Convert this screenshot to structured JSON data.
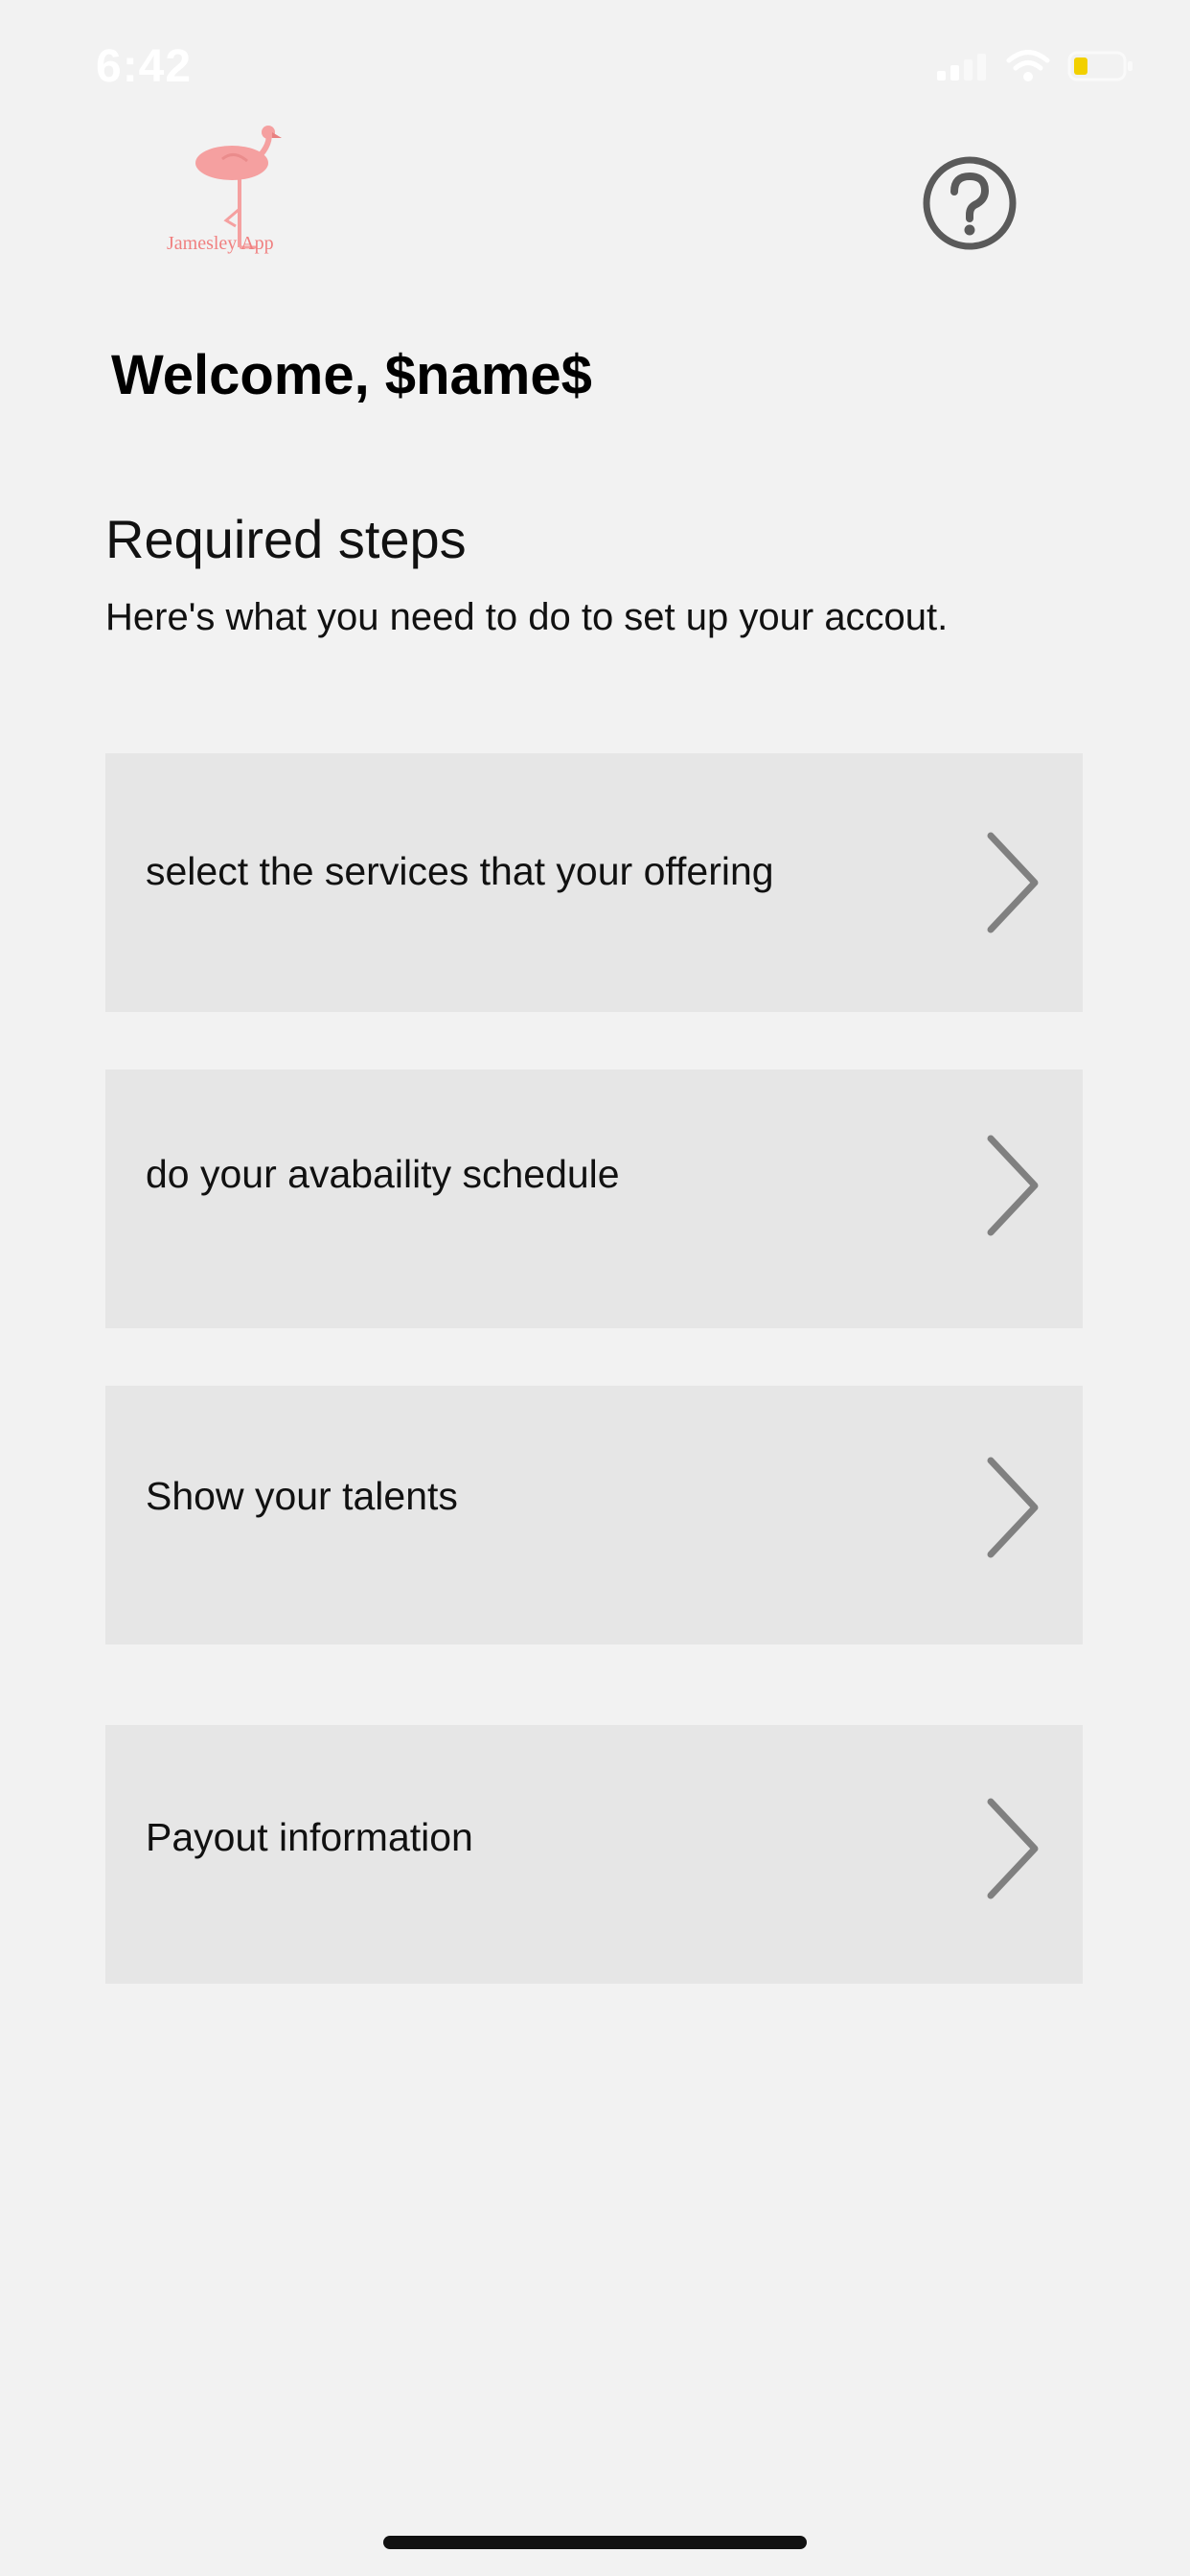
{
  "status_bar": {
    "time": "6:42"
  },
  "header": {
    "logo_text": "Jamesley App",
    "help_icon": "question-circle-icon"
  },
  "welcome": {
    "text": "Welcome, $name$"
  },
  "required_steps": {
    "title": "Required steps",
    "subtitle": "Here's what you need to do to set up your accout."
  },
  "steps": [
    {
      "label": "select the services that your offering",
      "icon": "chevron-right-icon"
    },
    {
      "label": "do your avabaility schedule",
      "icon": "chevron-right-icon"
    },
    {
      "label": "Show your talents",
      "icon": "chevron-right-icon"
    },
    {
      "label": "Payout information",
      "icon": "chevron-right-icon"
    }
  ],
  "colors": {
    "background": "#f2f2f2",
    "card": "#e6e6e6",
    "logo_pink": "#f5a0a0",
    "chevron": "#808080",
    "battery": "#f2d000"
  }
}
